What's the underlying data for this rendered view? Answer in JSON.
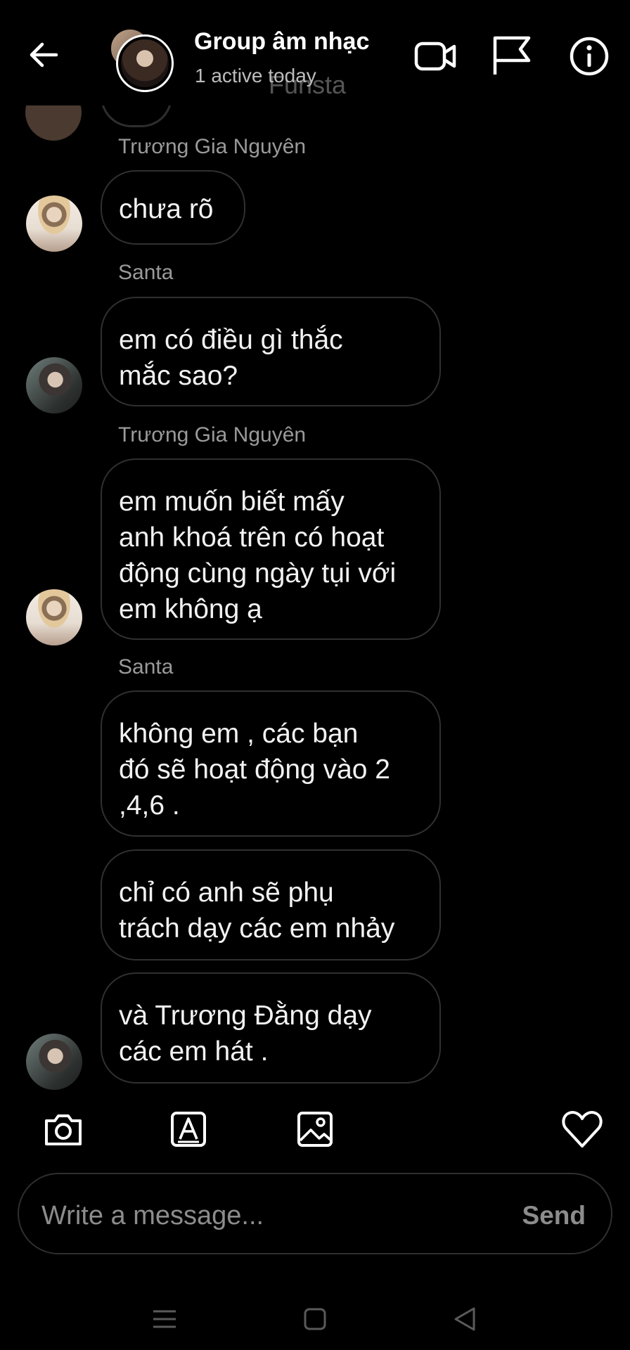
{
  "header": {
    "title": "Group âm nhạc",
    "subtitle": "1 active today",
    "ghost_text": "Funsta",
    "icons": [
      "back-arrow-icon",
      "video-call-icon",
      "flag-icon",
      "info-icon"
    ]
  },
  "messages": [
    {
      "sender": "Trương Gia Nguyên",
      "bubbles": [
        "chưa rõ"
      ]
    },
    {
      "sender": "Santa",
      "bubbles": [
        "em có điều gì thắc\nmắc sao?"
      ]
    },
    {
      "sender": "Trương Gia Nguyên",
      "bubbles": [
        "em muốn biết mấy\nanh khoá trên  có hoạt\nđộng cùng ngày tụi với\nem không ạ"
      ]
    },
    {
      "sender": "Santa",
      "bubbles": [
        "không em , các bạn\nđó sẽ hoạt động vào 2\n,4,6 .",
        "chỉ có anh sẽ phụ\ntrách dạy các em nhảy",
        "và Trương Đằng dạy\ncác em hát ."
      ]
    }
  ],
  "toolbar": {
    "icons": [
      "camera-icon",
      "sticker-icon",
      "gallery-icon",
      "heart-icon"
    ]
  },
  "composer": {
    "placeholder": "Write a message...",
    "value": "",
    "send_label": "Send"
  },
  "navbar": {
    "icons": [
      "menu-icon",
      "home-icon",
      "back-icon"
    ]
  },
  "colors": {
    "background": "#000000",
    "text": "#ffffff",
    "muted": "#9a9a9a",
    "bubble_border": "#303030"
  }
}
